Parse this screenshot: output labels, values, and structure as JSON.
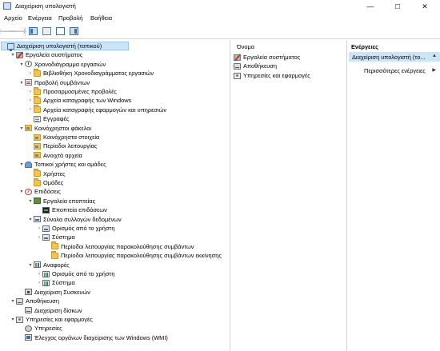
{
  "window": {
    "title": "Διαχείριση υπολογιστή",
    "minimize": "—",
    "maximize": "☐",
    "close": "✕"
  },
  "menu": [
    "Αρχείο",
    "Ενέργεια",
    "Προβολή",
    "Βοήθεια"
  ],
  "toolbar": {
    "back": "🡐",
    "forward": "🡒"
  },
  "tree": [
    {
      "label": "Διαχείριση υπολογιστή (τοπικού)",
      "icon": "computer-icon",
      "selected": true
    },
    {
      "label": "Εργαλεία συστήματος",
      "icon": "tools-icon",
      "expand": "▾"
    },
    {
      "label": "Χρονοδιάγραμμα εργασιών",
      "icon": "clock-icon",
      "expand": "▾"
    },
    {
      "label": "Βιβλιοθήκη Χρονοδιαγράμματος εργασιών",
      "icon": "folder-icon",
      "expand": "›"
    },
    {
      "label": "Προβολή συμβάντων",
      "icon": "event-viewer-icon",
      "expand": "▾"
    },
    {
      "label": "Προσαρμοσμένες προβολές",
      "icon": "folder-icon",
      "expand": "›"
    },
    {
      "label": "Αρχεία καταγραφής των Windows",
      "icon": "folder-icon",
      "expand": "›"
    },
    {
      "label": "Αρχεία καταγραφής εφαρμογών και υπηρεσιών",
      "icon": "folder-icon",
      "expand": "›"
    },
    {
      "label": "Εγγραφές",
      "icon": "log-icon"
    },
    {
      "label": "Κοινόχρηστοι φάκελοι",
      "icon": "shared-folder-icon",
      "expand": "▾"
    },
    {
      "label": "Κοινόχρηστα στοιχεία",
      "icon": "shared-folder-icon"
    },
    {
      "label": "Περίοδοι λειτουργίας",
      "icon": "shared-folder-icon"
    },
    {
      "label": "Ανοιχτά αρχεία",
      "icon": "shared-folder-icon"
    },
    {
      "label": "Τοπικοί χρήστες και ομάδες",
      "icon": "users-icon",
      "expand": "▾"
    },
    {
      "label": "Χρήστες",
      "icon": "folder-icon"
    },
    {
      "label": "Ομάδες",
      "icon": "folder-icon"
    },
    {
      "label": "Επιδόσεις",
      "icon": "performance-icon",
      "expand": "▾"
    },
    {
      "label": "Εργαλεία εποπτείας",
      "icon": "tool-icon",
      "expand": "▾"
    },
    {
      "label": "Εποπτεία επιδόσεων",
      "icon": "monitor-icon"
    },
    {
      "label": "Σύνολα συλλογών δεδομένων",
      "icon": "dataset-icon",
      "expand": "▾"
    },
    {
      "label": "Ορισμός από το χρήστη",
      "icon": "dataset-icon",
      "expand": "›"
    },
    {
      "label": "Σύστημα",
      "icon": "dataset-icon",
      "expand": "›"
    },
    {
      "label": "Περίοδοι λειτουργίας παρακολούθησης συμβάντων",
      "icon": "folder-icon"
    },
    {
      "label": "Περίοδοι λειτουργίας παρακολούθησης συμβάντων εκκίνησης",
      "icon": "folder-icon"
    },
    {
      "label": "Αναφορές",
      "icon": "report-icon",
      "expand": "▾"
    },
    {
      "label": "Ορισμός από το χρήστη",
      "icon": "report-icon",
      "expand": "›"
    },
    {
      "label": "Σύστημα",
      "icon": "report-icon",
      "expand": "›"
    },
    {
      "label": "Διαχείριση Συσκευών",
      "icon": "device-manager-icon"
    },
    {
      "label": "Αποθήκευση",
      "icon": "storage-icon",
      "expand": "▾"
    },
    {
      "label": "Διαχείριση δίσκων",
      "icon": "disk-icon"
    },
    {
      "label": "Υπηρεσίες και εφαρμογές",
      "icon": "services-icon",
      "expand": "▾"
    },
    {
      "label": "Υπηρεσίες",
      "icon": "service-icon"
    },
    {
      "label": "Έλεγχος οργάνων διαχείρισης των Windows (WMI)",
      "icon": "wmi-icon"
    }
  ],
  "middle": {
    "header": "Όνομα",
    "items": [
      {
        "label": "Εργαλεία συστήματος",
        "icon": "tools-icon"
      },
      {
        "label": "Αποθήκευση",
        "icon": "storage-icon"
      },
      {
        "label": "Υπηρεσίες και εφαρμογές",
        "icon": "services-icon"
      }
    ]
  },
  "actions": {
    "header": "Ενέργειες",
    "selected": "Διαχείριση υπολογιστή (το...",
    "collapse": "▲",
    "more": "Περισσότερες ενέργειες",
    "more_arrow": "▶"
  }
}
